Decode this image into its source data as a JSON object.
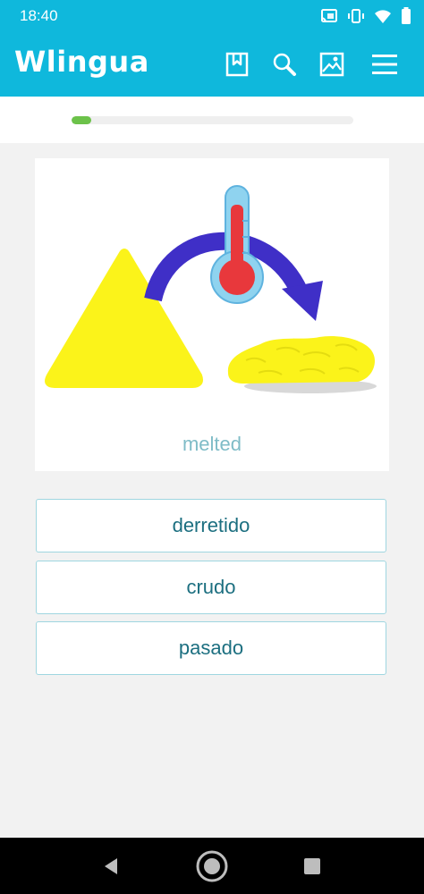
{
  "status_bar": {
    "time": "18:40"
  },
  "app_bar": {
    "logo": "Wlingua"
  },
  "lesson": {
    "progress": 0.07
  },
  "card": {
    "word": "melted"
  },
  "options": [
    {
      "label": "derretido"
    },
    {
      "label": "crudo"
    },
    {
      "label": "pasado"
    }
  ],
  "colors": {
    "brand": "#0fb8dc",
    "progress": "#6cc24a",
    "option_text": "#1c6f80",
    "word": "#7fbcc7"
  }
}
